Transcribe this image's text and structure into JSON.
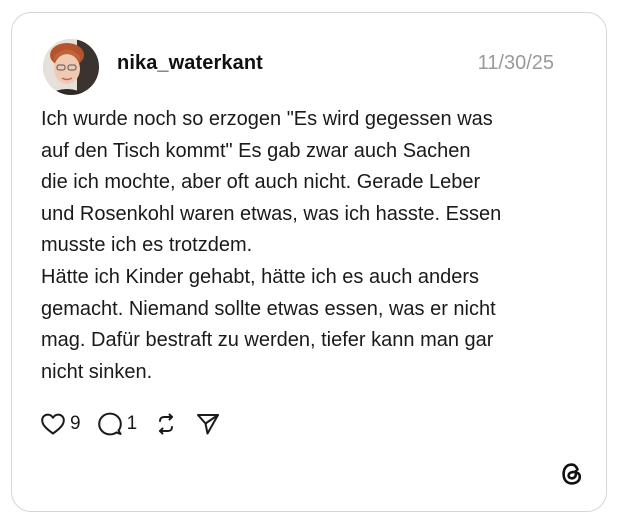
{
  "post": {
    "username": "nika_waterkant",
    "date": "11/30/25",
    "lines": [
      "Ich wurde noch so erzogen \"Es wird gegessen was",
      "auf den Tisch kommt\" Es gab zwar auch Sachen",
      "die ich mochte, aber oft auch nicht. Gerade Leber",
      "und Rosenkohl waren etwas, was ich hasste. Essen",
      "musste ich es trotzdem.",
      "Hätte ich Kinder gehabt, hätte ich es auch anders",
      "gemacht. Niemand sollte etwas essen, was er nicht",
      "mag. Dafür bestraft zu werden, tiefer kann man gar",
      "nicht sinken."
    ]
  },
  "actions": {
    "like_count": "9",
    "reply_count": "1",
    "like_icon": "heart-icon",
    "reply_icon": "comment-bubble-icon",
    "repost_icon": "repost-icon",
    "share_icon": "send-icon"
  },
  "brand": {
    "logo_icon": "threads-logo-icon"
  }
}
